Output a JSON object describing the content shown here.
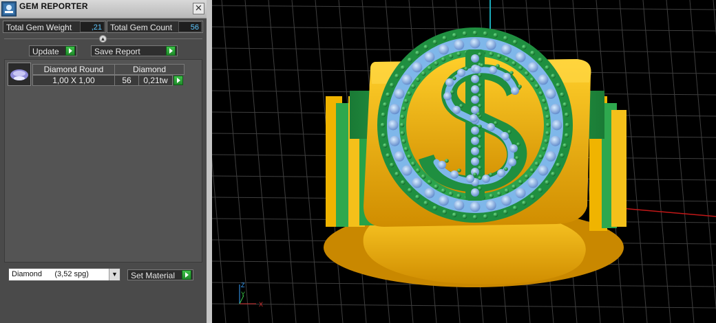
{
  "panel": {
    "title": "GEM REPORTER",
    "close_glyph": "✕",
    "total_weight_label": "Total Gem Weight",
    "total_weight_value": ",21",
    "total_count_label": "Total Gem Count",
    "total_count_value": "56",
    "update_label": "Update",
    "save_report_label": "Save Report",
    "table": {
      "header_name": "Diamond Round",
      "header_material": "Diamond",
      "size": "1,00 X 1,00",
      "count": "56",
      "weight": "0,21tw"
    },
    "material_select_value": "Diamond      (3,52 spg)",
    "set_material_label": "Set Material"
  },
  "viewport": {
    "axis_labels": {
      "z": "Z",
      "y": "Y",
      "x": "X"
    },
    "colors": {
      "background": "#000000",
      "grid": "#3f3f3f",
      "ring_gold": "#f0b400",
      "prongs_green": "#23a049",
      "gems_blue": "#7aa8e8",
      "x_axis": "#c41818",
      "z_axis": "#1aa9b8"
    }
  }
}
